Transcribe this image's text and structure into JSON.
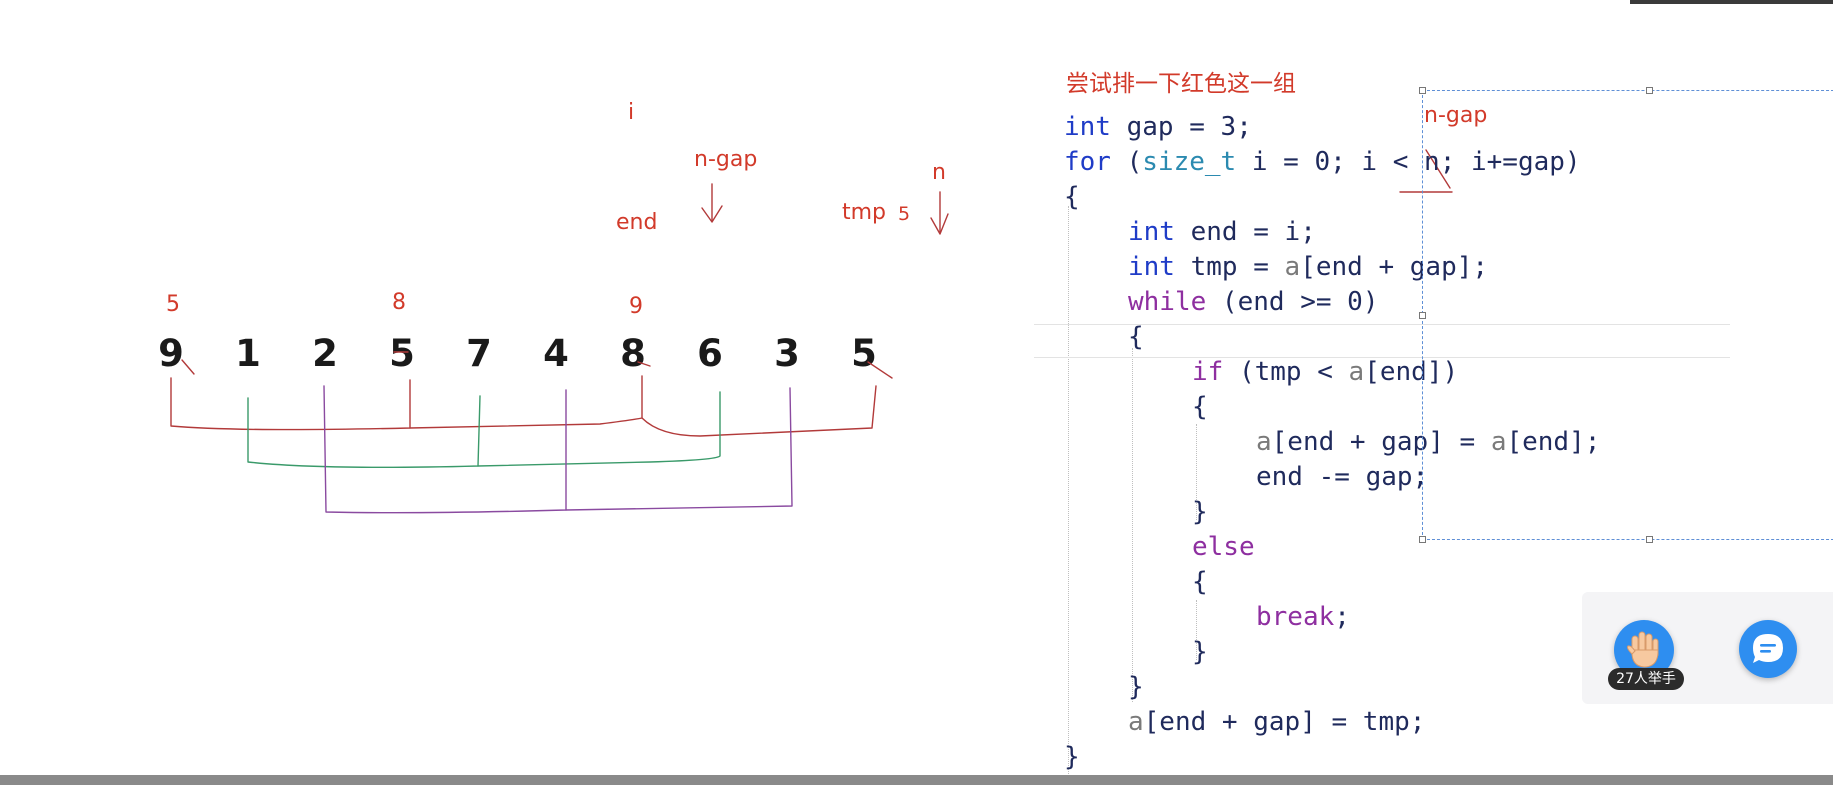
{
  "note": {
    "title": "尝试排一下红色这一组"
  },
  "annotations": {
    "i": "i",
    "n_gap": "n-gap",
    "n": "n",
    "end": "end",
    "tmp": "tmp",
    "tmp_value": "5",
    "above_values": [
      "5",
      "8",
      "9"
    ],
    "n_gap_code": "n-gap"
  },
  "array": [
    "9",
    "1",
    "2",
    "5",
    "7",
    "4",
    "8",
    "6",
    "3",
    "5"
  ],
  "code": {
    "l1": {
      "kw": "int",
      "rest": " gap = 3;"
    },
    "l2": {
      "kw": "for",
      "p1": " (",
      "ty": "size_t",
      "p2": " i = 0; i < n; i+=gap)"
    },
    "l3": {
      "text": "{"
    },
    "l4": {
      "kw": "int",
      "rest": " end = i;"
    },
    "l5": {
      "kw": "int",
      "p1": " tmp = ",
      "a": "a",
      "p2": "[end + gap];"
    },
    "l6": {
      "kw": "while",
      "rest": " (end >= 0)"
    },
    "l7": {
      "text": "{"
    },
    "l8": {
      "kw": "if",
      "p1": " (tmp < ",
      "a": "a",
      "p2": "[end])"
    },
    "l9": {
      "text": "{"
    },
    "l10": {
      "a": "a",
      "p1": "[end + gap] = ",
      "a2": "a",
      "p2": "[end];"
    },
    "l11": {
      "text": "end -= gap;"
    },
    "l12": {
      "text": "}"
    },
    "l13": {
      "kw": "else"
    },
    "l14": {
      "text": "{"
    },
    "l15": {
      "kw": "break",
      "rest": ";"
    },
    "l16": {
      "text": "}"
    },
    "l17": {
      "text": "}"
    },
    "l18": {
      "a": "a",
      "rest": "[end + gap] = tmp;"
    },
    "l19": {
      "text": "}"
    }
  },
  "widgets": {
    "raise_hand_count": "27人举手",
    "raise_hand_icon": "raise-hand-icon",
    "chat_icon": "chat-icon"
  },
  "colors": {
    "annotation_red": "#d23a2a",
    "group_red": "#b23a3a",
    "group_green": "#3a9a6a",
    "group_purple": "#8a4aa0",
    "accent_blue": "#2e8ef0"
  }
}
